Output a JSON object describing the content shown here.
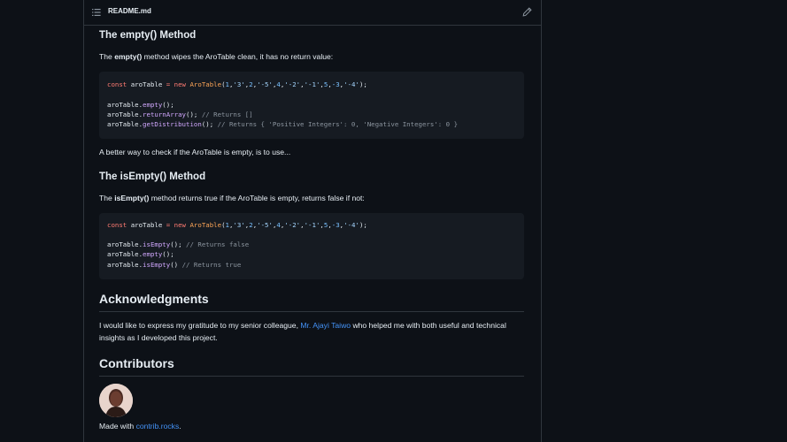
{
  "file_header": {
    "file_name": "README.md"
  },
  "section_empty": {
    "heading": "The empty() Method",
    "intro_prefix": "The ",
    "intro_bold": "empty()",
    "intro_suffix": " method wipes the AroTable clean, it has no return value:",
    "code": {
      "line1": {
        "kw1": "const",
        "v1": " aroTable ",
        "op": "=",
        "sp": " ",
        "kw2": "new",
        "sp2": " ",
        "cls": "AroTable",
        "args_open": "(",
        "args": [
          {
            "t": "num",
            "v": "1"
          },
          {
            "t": "p",
            "v": ","
          },
          {
            "t": "str",
            "v": "'3'"
          },
          {
            "t": "p",
            "v": ","
          },
          {
            "t": "num",
            "v": "2"
          },
          {
            "t": "p",
            "v": ","
          },
          {
            "t": "str",
            "v": "'-5'"
          },
          {
            "t": "p",
            "v": ","
          },
          {
            "t": "num",
            "v": "4"
          },
          {
            "t": "p",
            "v": ","
          },
          {
            "t": "str",
            "v": "'-2'"
          },
          {
            "t": "p",
            "v": ","
          },
          {
            "t": "str",
            "v": "'-1'"
          },
          {
            "t": "p",
            "v": ","
          },
          {
            "t": "num",
            "v": "5"
          },
          {
            "t": "p",
            "v": ","
          },
          {
            "t": "num",
            "v": "-3"
          },
          {
            "t": "p",
            "v": ","
          },
          {
            "t": "str",
            "v": "'-4'"
          }
        ],
        "args_close": ");"
      },
      "line2": {
        "obj": "aroTable.",
        "fn": "empty",
        "rest": "();",
        "cm": ""
      },
      "line3": {
        "obj": "aroTable.",
        "fn": "returnArray",
        "rest": "(); ",
        "cm": "// Returns []"
      },
      "line4": {
        "obj": "aroTable.",
        "fn": "getDistribution",
        "rest": "(); ",
        "cm": "// Returns { 'Positive Integers': 0, 'Negative Integers': 0 }"
      }
    },
    "after": "A better way to check if the AroTable is empty, is to use..."
  },
  "section_isempty": {
    "heading": "The isEmpty() Method",
    "intro_prefix": "The ",
    "intro_bold": "isEmpty()",
    "intro_suffix": " method returns true if the AroTable is empty, returns false if not:",
    "code": {
      "line2": {
        "obj": "aroTable.",
        "fn": "isEmpty",
        "rest": "(); ",
        "cm": "// Returns false"
      },
      "line3": {
        "obj": "aroTable.",
        "fn": "empty",
        "rest": "();",
        "cm": ""
      },
      "line4": {
        "obj": "aroTable.",
        "fn": "isEmpty",
        "rest": "() ",
        "cm": "// Returns true"
      }
    }
  },
  "acknowledgments": {
    "heading": "Acknowledgments",
    "text_prefix": "I would like to express my gratitude to my senior colleague, ",
    "link": "Mr. Ajayi Taiwo",
    "text_suffix": " who helped me with both useful and technical insights as I developed this project."
  },
  "contributors": {
    "heading": "Contributors",
    "made_with_prefix": "Made with ",
    "made_with_link": "contrib.rocks",
    "made_with_suffix": "."
  },
  "colors": {
    "background": "#0d1117",
    "code_bg": "#161b22",
    "border": "#30363d",
    "link": "#4493f8"
  }
}
